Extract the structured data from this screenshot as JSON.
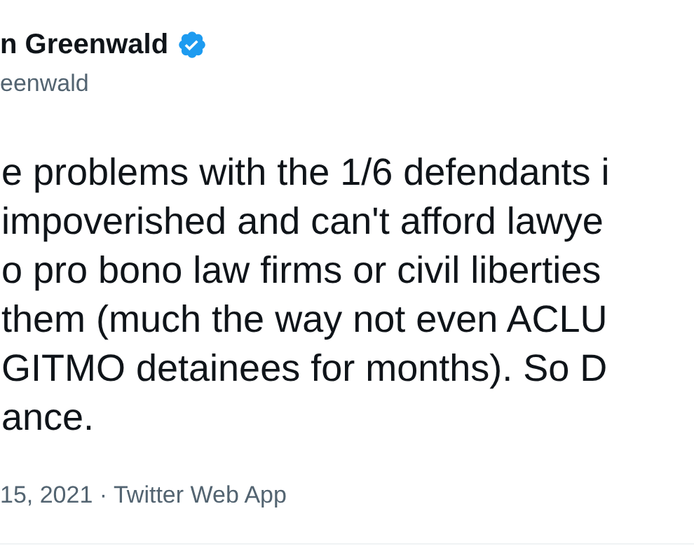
{
  "author": {
    "name": "n Greenwald",
    "verified": true,
    "handle": "eenwald"
  },
  "tweet_lines": [
    "e problems with the 1/6 defendants i",
    "impoverished and can't afford lawye",
    "o pro bono law firms or civil liberties",
    "them (much the way not even ACLU",
    "GITMO detainees for months). So D",
    "ance."
  ],
  "meta": "15, 2021 · Twitter Web App"
}
